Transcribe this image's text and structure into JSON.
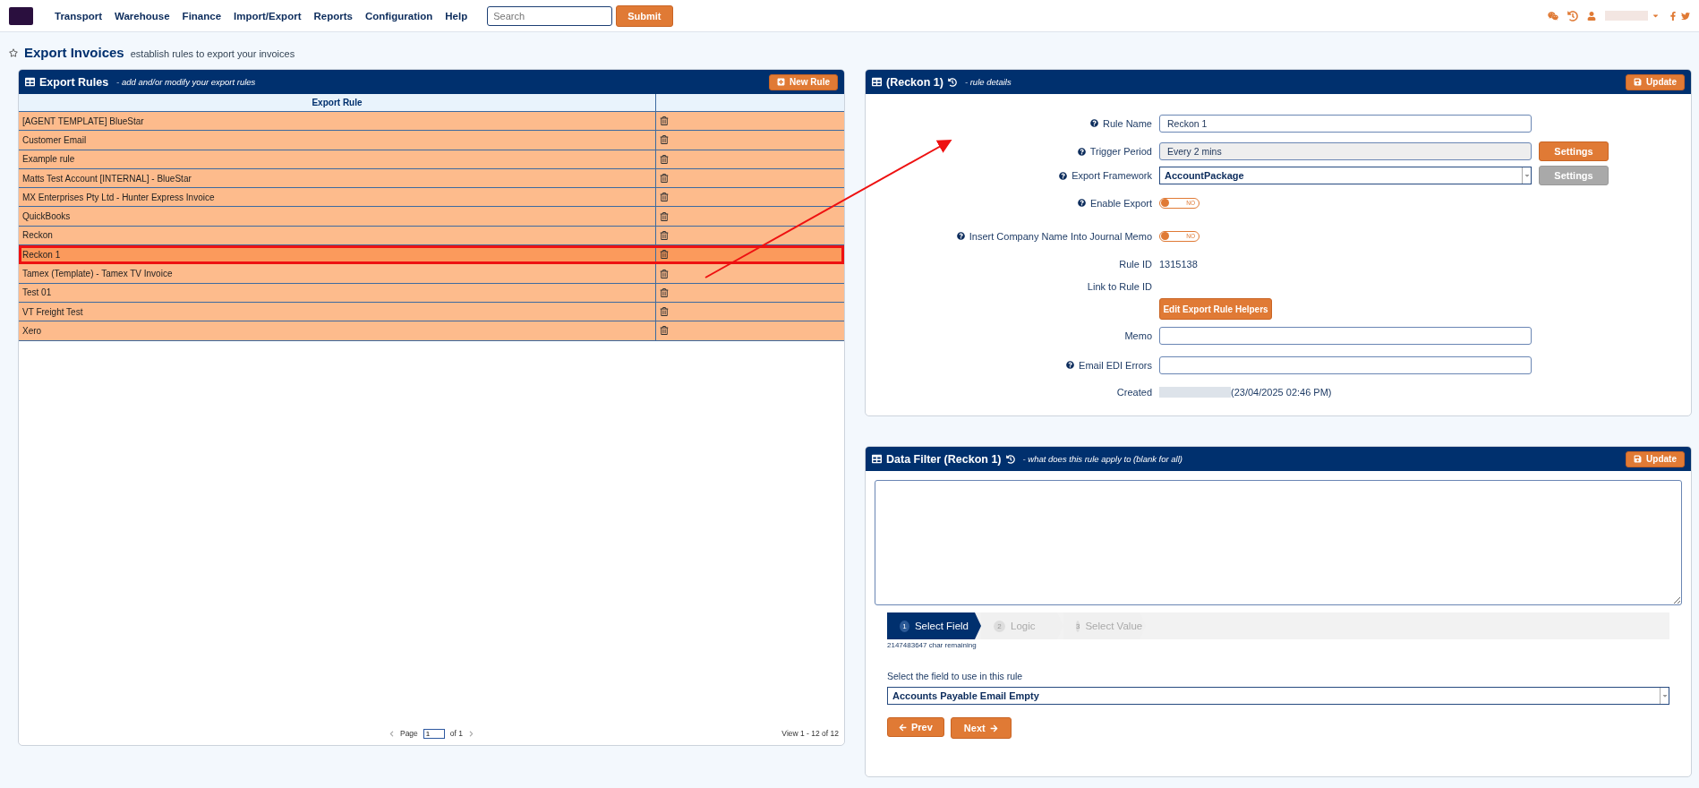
{
  "nav": {
    "menu": [
      "Transport",
      "Warehouse",
      "Finance",
      "Import/Export",
      "Reports",
      "Configuration",
      "Help"
    ],
    "search": {
      "placeholder": "Search"
    },
    "submit": "Submit"
  },
  "page": {
    "title": "Export Invoices",
    "subtitle": "establish rules to export your invoices"
  },
  "rules_panel": {
    "title": "Export Rules",
    "subtitle": "- add and/or modify your export rules",
    "new_button": "New Rule",
    "column": "Export Rule",
    "rows": [
      {
        "name": "[AGENT TEMPLATE] BlueStar",
        "selected": false
      },
      {
        "name": "Customer Email",
        "selected": false
      },
      {
        "name": "Example rule",
        "selected": false
      },
      {
        "name": "Matts Test Account [INTERNAL] - BlueStar",
        "selected": false
      },
      {
        "name": "MX Enterprises Pty Ltd - Hunter Express Invoice",
        "selected": false
      },
      {
        "name": "QuickBooks",
        "selected": false
      },
      {
        "name": "Reckon",
        "selected": false
      },
      {
        "name": "Reckon 1",
        "selected": true
      },
      {
        "name": "Tamex (Template) - Tamex TV Invoice",
        "selected": false
      },
      {
        "name": "Test 01",
        "selected": false
      },
      {
        "name": "VT Freight Test",
        "selected": false
      },
      {
        "name": "Xero",
        "selected": false
      }
    ],
    "pager": {
      "page_label": "Page",
      "page": "1",
      "of": "of 1",
      "view": "View 1 - 12 of 12"
    }
  },
  "details_panel": {
    "title": "(Reckon 1)",
    "subtitle": "- rule details",
    "update": "Update",
    "fields": [
      {
        "kind": "input",
        "label": "Rule Name",
        "help": true,
        "value": "Reckon 1"
      },
      {
        "kind": "readonly",
        "label": "Trigger Period",
        "help": true,
        "value": "Every 2 mins",
        "button": "Settings",
        "disabled": false
      },
      {
        "kind": "select",
        "label": "Export Framework",
        "help": true,
        "value": "AccountPackage",
        "button": "Settings",
        "disabled": true
      },
      {
        "kind": "toggle",
        "label": "Enable Export",
        "help": true,
        "on": false,
        "state": "NO"
      },
      {
        "kind": "toggle",
        "label": "Insert Company Name Into Journal Memo",
        "help": true,
        "on": false,
        "state": "NO"
      },
      {
        "kind": "text",
        "label": "Rule ID",
        "help": false,
        "value": "1315138"
      },
      {
        "kind": "text",
        "label": "Link to Rule ID",
        "help": false
      },
      {
        "kind": "button",
        "button": "Edit Export Rule Helpers"
      },
      {
        "kind": "input",
        "label": "Memo",
        "help": false
      },
      {
        "kind": "input",
        "label": "Email EDI Errors",
        "help": true
      },
      {
        "kind": "created",
        "label": "Created",
        "help": false,
        "value": "(23/04/2025 02:46 PM)"
      }
    ]
  },
  "filter_panel": {
    "title": "Data Filter (Reckon 1)",
    "subtitle": "- what does this rule apply to (blank for all)",
    "update": "Update",
    "steps": [
      {
        "number": "1",
        "label": "Select Field",
        "selected": true
      },
      {
        "number": "2",
        "label": "Logic",
        "selected": false
      },
      {
        "number": "3",
        "label": "Select Value",
        "selected": false
      }
    ],
    "char_remaining": "2147483647 char remaining",
    "select_label": "Select the field to use in this rule",
    "select_value": "Accounts Payable Email Empty",
    "prev": "Prev",
    "next": "Next"
  }
}
